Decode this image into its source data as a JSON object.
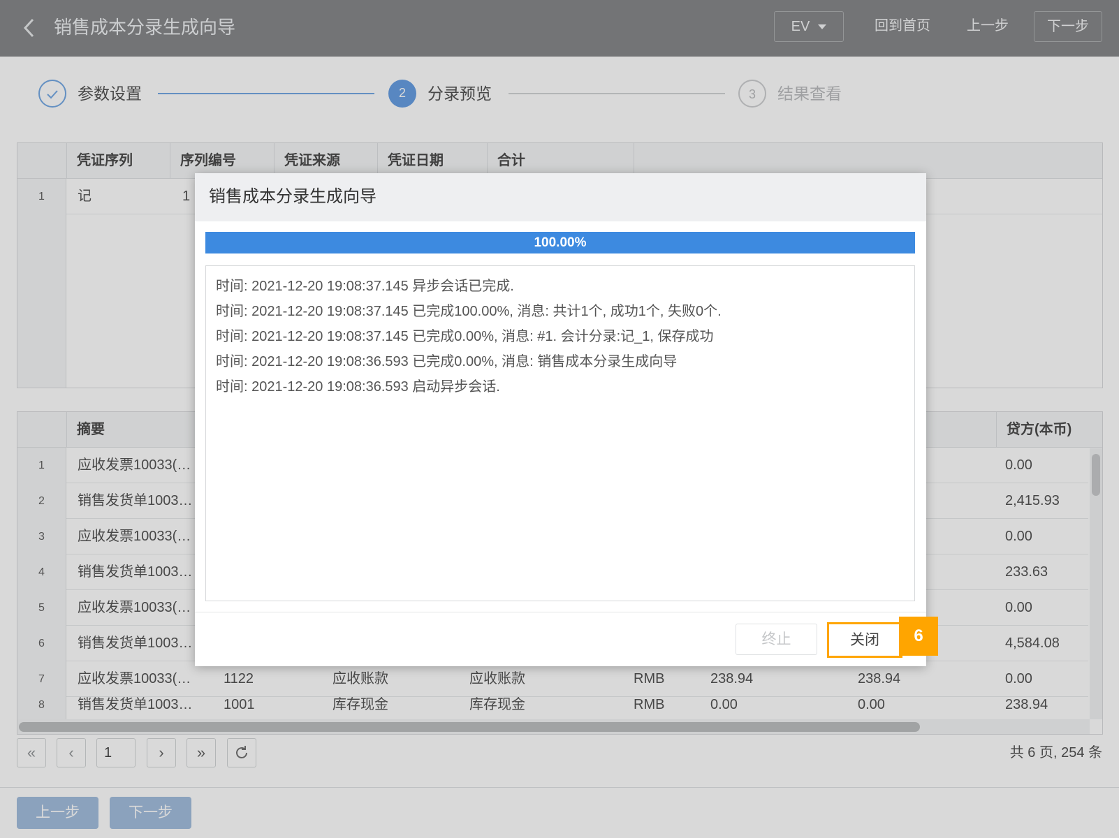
{
  "header": {
    "title": "销售成本分录生成向导",
    "ev_label": "EV",
    "home_label": "回到首页",
    "prev_label": "上一步",
    "next_label": "下一步"
  },
  "steps": [
    {
      "label": "参数设置",
      "number": "",
      "state": "done"
    },
    {
      "label": "分录预览",
      "number": "2",
      "state": "active"
    },
    {
      "label": "结果查看",
      "number": "3",
      "state": "pending"
    }
  ],
  "voucher_table": {
    "columns": [
      "凭证序列",
      "序列编号",
      "凭证来源",
      "凭证日期",
      "合计"
    ],
    "rows": [
      {
        "index": "1",
        "series": "记",
        "number": "1"
      }
    ]
  },
  "entry_table": {
    "columns": {
      "summary": "摘要",
      "credit": "贷方(本币)"
    },
    "rows": [
      {
        "index": "1",
        "summary": "应收发票10033(…",
        "credit": "0.00"
      },
      {
        "index": "2",
        "summary": "销售发货单1003…",
        "credit": "2,415.93"
      },
      {
        "index": "3",
        "summary": "应收发票10033(…",
        "credit": "0.00"
      },
      {
        "index": "4",
        "summary": "销售发货单1003…",
        "credit": "233.63"
      },
      {
        "index": "5",
        "summary": "应收发票10033(…",
        "credit": "0.00"
      },
      {
        "index": "6",
        "summary": "销售发货单1003…",
        "credit": "4,584.08"
      },
      {
        "index": "7",
        "summary": "应收发票10033(…",
        "account_code": "1122",
        "account_name": "应收账款",
        "account_full": "应收账款",
        "currency": "RMB",
        "orig_amount": "238.94",
        "debit": "238.94",
        "credit": "0.00"
      },
      {
        "index": "8",
        "summary": "销售发货单1003…",
        "account_code": "1001",
        "account_name": "库存现金",
        "account_full": "库存现金",
        "currency": "RMB",
        "orig_amount": "0.00",
        "debit": "0.00",
        "credit": "238.94"
      }
    ]
  },
  "pagination": {
    "current_page": "1",
    "summary": "共 6 页, 254 条"
  },
  "footer": {
    "prev_label": "上一步",
    "next_label": "下一步"
  },
  "dialog": {
    "title": "销售成本分录生成向导",
    "progress_percent": 100,
    "progress_text": "100.00%",
    "log": [
      "时间: 2021-12-20 19:08:37.145 异步会话已完成.",
      "时间: 2021-12-20 19:08:37.145 已完成100.00%, 消息: 共计1个, 成功1个, 失败0个.",
      "时间: 2021-12-20 19:08:37.145 已完成0.00%, 消息: #1. 会计分录:记_1, 保存成功",
      "时间: 2021-12-20 19:08:36.593 已完成0.00%, 消息: 销售成本分录生成向导",
      "时间: 2021-12-20 19:08:36.593 启动异步会话."
    ],
    "stop_label": "终止",
    "close_label": "关闭"
  },
  "callout_number": "6",
  "colors": {
    "accent": "#3d8ae0",
    "highlight": "#ffa500",
    "topbar": "#7d7e80"
  }
}
